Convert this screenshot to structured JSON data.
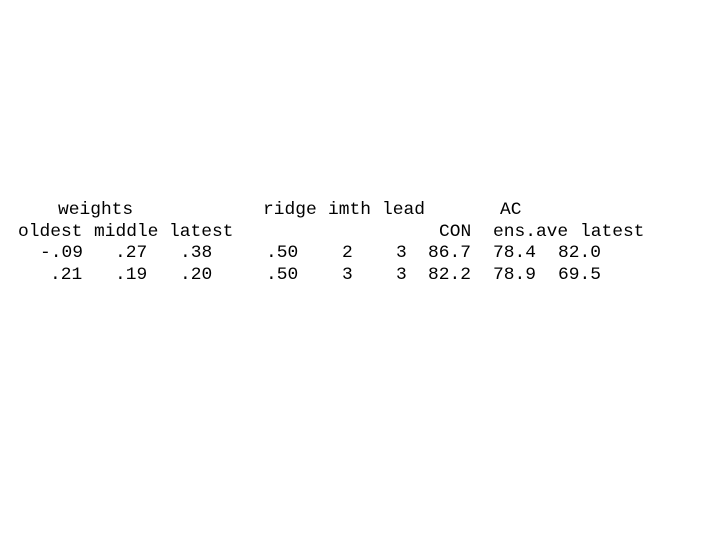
{
  "table": {
    "group_headers": {
      "weights": "weights",
      "ridge": "ridge",
      "imth": "imth",
      "lead": "lead",
      "ac": "AC"
    },
    "column_headers": {
      "oldest": "oldest",
      "middle": "middle",
      "latest": "latest",
      "con": "CON",
      "ens_ave": "ens.ave",
      "ac_latest": "latest"
    },
    "rows": [
      {
        "oldest": "-.09",
        "middle": ".27",
        "latest": ".38",
        "ridge": ".50",
        "imth": "2",
        "lead": "3",
        "con": "86.7",
        "ens_ave": "78.4",
        "ac_latest": "82.0"
      },
      {
        "oldest": ".21",
        "middle": ".19",
        "latest": ".20",
        "ridge": ".50",
        "imth": "3",
        "lead": "3",
        "con": "82.2",
        "ens_ave": "78.9",
        "ac_latest": "69.5"
      }
    ]
  }
}
